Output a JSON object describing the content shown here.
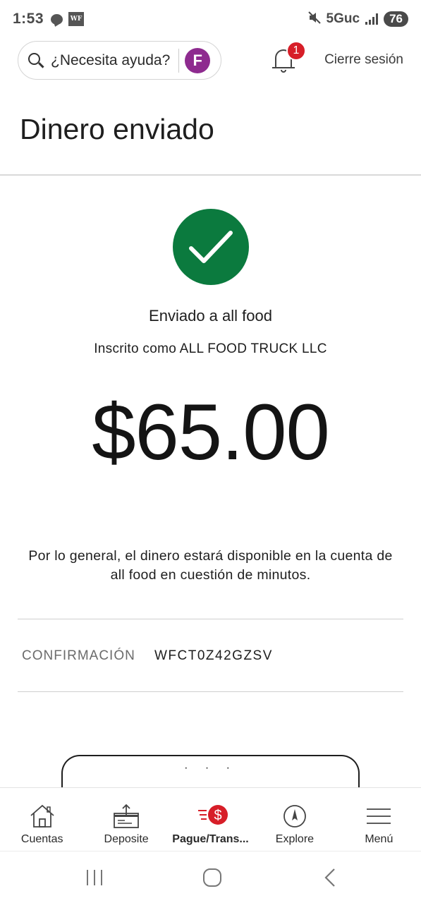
{
  "status_bar": {
    "time": "1:53",
    "wf_badge": "WF",
    "network": "5Guc",
    "battery": "76"
  },
  "header": {
    "search_placeholder": "¿Necesita ayuda?",
    "assistant_icon": "F",
    "notification_count": "1",
    "logout_label": "Cierre sesión"
  },
  "page": {
    "title": "Dinero enviado"
  },
  "confirmation": {
    "sent_to": "Enviado a all food",
    "registered_as": "Inscrito como ALL FOOD TRUCK LLC",
    "amount": "$65.00",
    "note": "Por lo general, el dinero estará disponible en la cuenta de all food en cuestión de minutos.",
    "confirmation_label": "CONFIRMACIÓN",
    "confirmation_number": "WFCT0Z42GZSV",
    "success_color": "#0b7a3e"
  },
  "bottom_nav": {
    "items": [
      {
        "label": "Cuentas",
        "icon": "home-icon"
      },
      {
        "label": "Deposite",
        "icon": "deposit-icon"
      },
      {
        "label": "Pague/Trans...",
        "icon": "pay-transfer-icon"
      },
      {
        "label": "Explore",
        "icon": "compass-icon"
      },
      {
        "label": "Menú",
        "icon": "hamburger-menu-icon"
      }
    ],
    "active_index": 2,
    "brand_color": "#d71e28"
  }
}
